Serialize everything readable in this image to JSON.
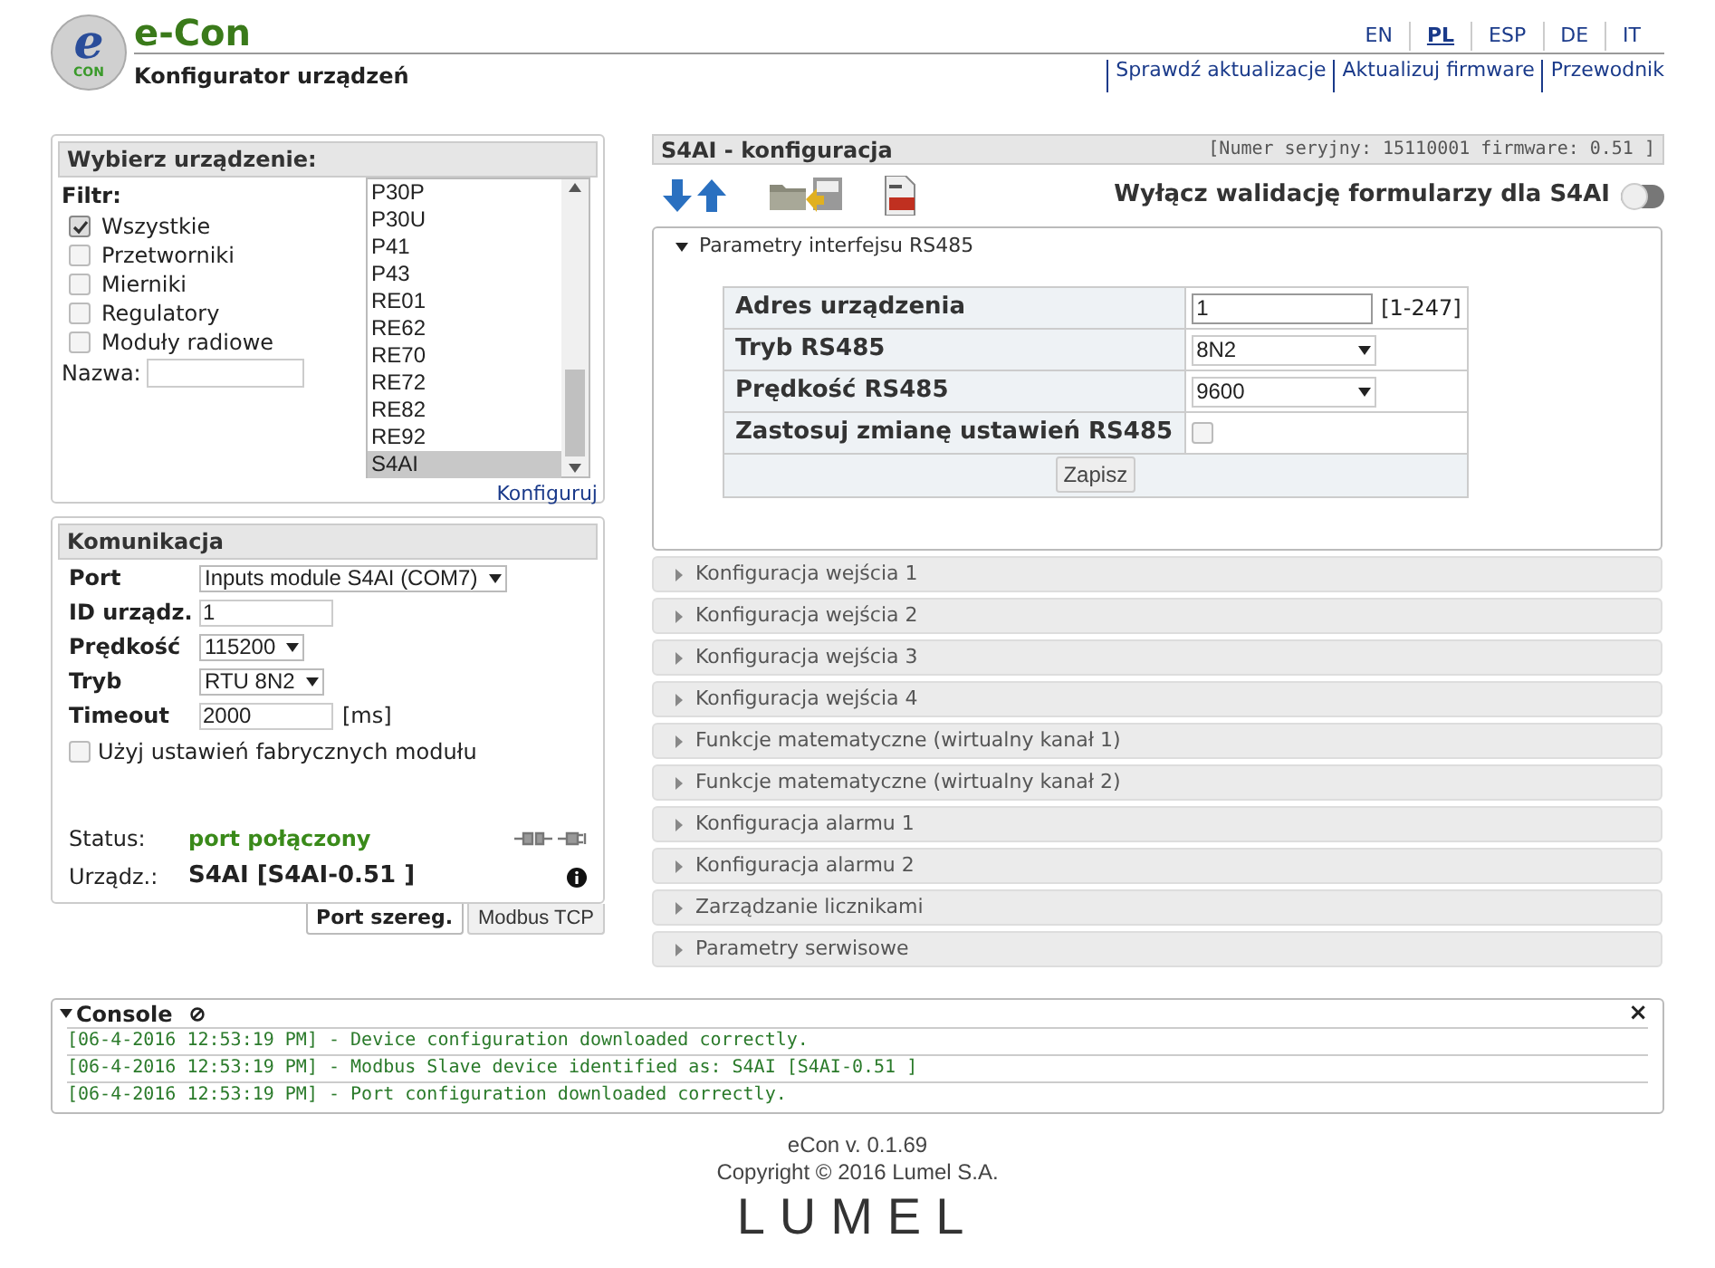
{
  "header": {
    "logo": {
      "letter": "e",
      "sub": "CON"
    },
    "title": "e-Con",
    "subtitle": "Konfigurator urządzeń",
    "languages": [
      {
        "label": "EN",
        "selected": false
      },
      {
        "label": "PL",
        "selected": true
      },
      {
        "label": "ESP",
        "selected": false
      },
      {
        "label": "DE",
        "selected": false
      },
      {
        "label": "IT",
        "selected": false
      }
    ],
    "links": [
      "Sprawdź aktualizacje",
      "Aktualizuj firmware",
      "Przewodnik"
    ]
  },
  "device_panel": {
    "title": "Wybierz urządzenie:",
    "filter_label": "Filtr:",
    "filters": [
      {
        "label": "Wszystkie",
        "checked": true
      },
      {
        "label": "Przetworniki",
        "checked": false
      },
      {
        "label": "Mierniki",
        "checked": false
      },
      {
        "label": "Regulatory",
        "checked": false
      },
      {
        "label": "Moduły radiowe",
        "checked": false
      }
    ],
    "name_label": "Nazwa:",
    "devices": [
      {
        "label": "P30P",
        "selected": false
      },
      {
        "label": "P30U",
        "selected": false
      },
      {
        "label": "P41",
        "selected": false
      },
      {
        "label": "P43",
        "selected": false
      },
      {
        "label": "RE01",
        "selected": false
      },
      {
        "label": "RE62",
        "selected": false
      },
      {
        "label": "RE70",
        "selected": false
      },
      {
        "label": "RE72",
        "selected": false
      },
      {
        "label": "RE82",
        "selected": false
      },
      {
        "label": "RE92",
        "selected": false
      },
      {
        "label": "S4AI",
        "selected": true
      }
    ],
    "configure_link": "Konfiguruj"
  },
  "comm_panel": {
    "title": "Komunikacja",
    "fields": [
      {
        "label": "Port",
        "kind": "select",
        "value": "Inputs module S4AI (COM7)"
      },
      {
        "label": "ID urządz.",
        "kind": "input",
        "value": "1"
      },
      {
        "label": "Prędkość",
        "kind": "select",
        "value": "115200"
      },
      {
        "label": "Tryb",
        "kind": "select",
        "value": "RTU 8N2"
      },
      {
        "label": "Timeout",
        "kind": "input",
        "value": "2000",
        "unit": "[ms]"
      }
    ],
    "factory": {
      "label": "Użyj ustawień fabrycznych modułu",
      "checked": false
    },
    "status_label": "Status:",
    "status_value": "port połączony",
    "device_label": "Urządz.:",
    "device_value": "S4AI [S4AI-0.51 ]",
    "tabs": [
      {
        "label": "Port szereg.",
        "selected": true
      },
      {
        "label": "Modbus TCP",
        "selected": false
      }
    ]
  },
  "config": {
    "title": "S4AI - konfiguracja",
    "serial": "[Numer seryjny: 15110001 firmware: 0.51 ]",
    "validation_label": "Wyłącz walidację formularzy dla S4AI",
    "validation_on": false,
    "sections": [
      {
        "label": "Parametry interfejsu RS485",
        "expanded": true,
        "rows": [
          {
            "label": "Adres urządzenia",
            "kind": "input",
            "value": "1",
            "hint": "[1-247]"
          },
          {
            "label": "Tryb RS485",
            "kind": "select",
            "value": "8N2"
          },
          {
            "label": "Prędkość RS485",
            "kind": "select",
            "value": "9600"
          },
          {
            "label": "Zastosuj zmianę ustawień RS485",
            "kind": "checkbox",
            "checked": false
          }
        ],
        "save": "Zapisz"
      },
      {
        "label": "Konfiguracja wejścia 1",
        "expanded": false
      },
      {
        "label": "Konfiguracja wejścia 2",
        "expanded": false
      },
      {
        "label": "Konfiguracja wejścia 3",
        "expanded": false
      },
      {
        "label": "Konfiguracja wejścia 4",
        "expanded": false
      },
      {
        "label": "Funkcje matematyczne (wirtualny kanał 1)",
        "expanded": false
      },
      {
        "label": "Funkcje matematyczne (wirtualny kanał 2)",
        "expanded": false
      },
      {
        "label": "Konfiguracja alarmu 1",
        "expanded": false
      },
      {
        "label": "Konfiguracja alarmu 2",
        "expanded": false
      },
      {
        "label": "Zarządzanie licznikami",
        "expanded": false
      },
      {
        "label": "Parametry serwisowe",
        "expanded": false
      }
    ]
  },
  "console": {
    "title": "Console",
    "close": "×",
    "lines": [
      "[06-4-2016 12:53:19 PM] - Device configuration downloaded correctly.",
      "[06-4-2016 12:53:19 PM] - Modbus Slave device identified as: S4AI [S4AI-0.51 ]",
      "[06-4-2016 12:53:19 PM] - Port configuration downloaded correctly."
    ]
  },
  "footer": {
    "version": "eCon v. 0.1.69",
    "copyright": "Copyright © 2016 Lumel S.A.",
    "brand": "LUMEL"
  }
}
